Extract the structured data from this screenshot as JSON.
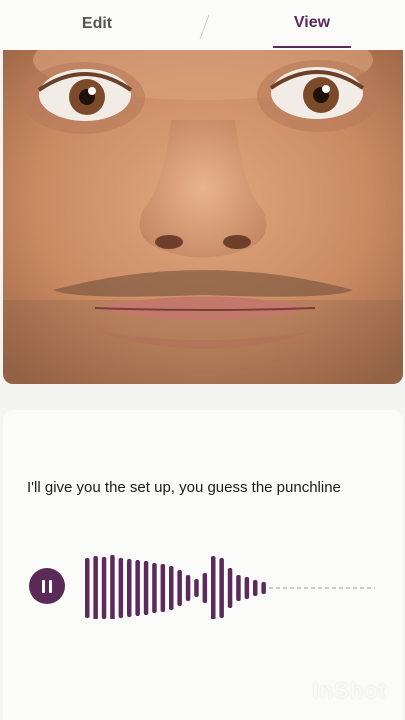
{
  "tabs": {
    "edit_label": "Edit",
    "view_label": "View",
    "active": "View"
  },
  "message": {
    "caption": "I'll give you the set up, you guess the punchline"
  },
  "audio": {
    "state": "playing",
    "control_icon": "pause-icon",
    "accent_color": "#5a2a59"
  },
  "watermark": "InShot",
  "colors": {
    "accent": "#5a2a59",
    "card_bg": "#fbfbfa",
    "page_bg": "#f4f4f2"
  }
}
